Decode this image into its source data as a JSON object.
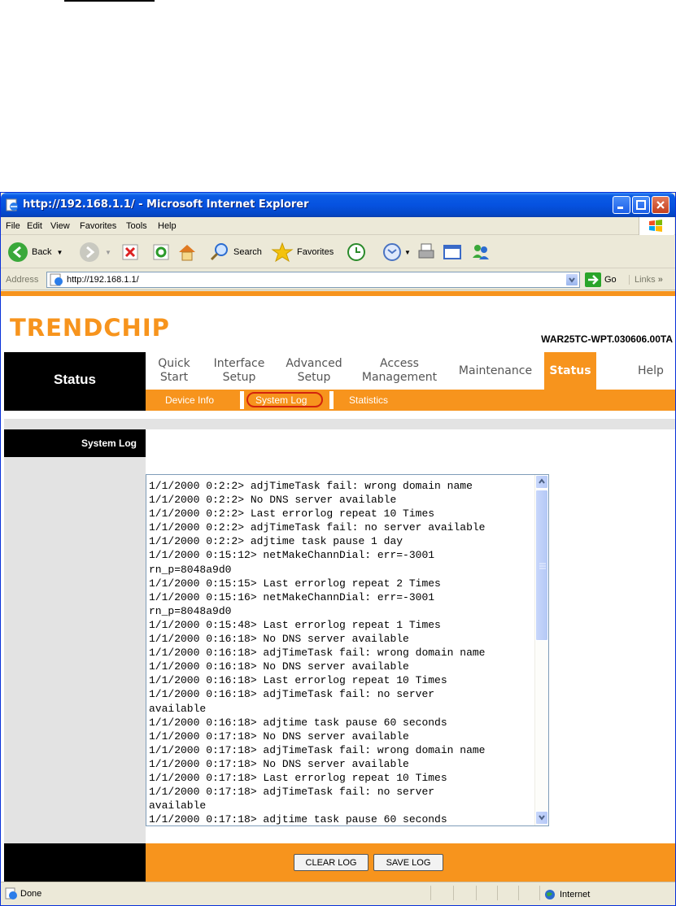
{
  "window": {
    "title": "http://192.168.1.1/ - Microsoft Internet Explorer"
  },
  "menu": [
    "File",
    "Edit",
    "View",
    "Favorites",
    "Tools",
    "Help"
  ],
  "toolbar": {
    "back": "Back",
    "search": "Search",
    "favorites": "Favorites"
  },
  "address": {
    "label": "Address",
    "url": "http://192.168.1.1/",
    "go": "Go",
    "links": "Links"
  },
  "page": {
    "brand": "TRENDCHIP",
    "firmware": "WAR25TC-WPT.030606.00TA",
    "section": "Status",
    "tabs": [
      {
        "label": "Quick\nStart"
      },
      {
        "label": "Interface\nSetup"
      },
      {
        "label": "Advanced\nSetup"
      },
      {
        "label": "Access\nManagement"
      },
      {
        "label": "Maintenance"
      },
      {
        "label": "Status"
      },
      {
        "label": "Help"
      }
    ],
    "subtabs": [
      "Device Info",
      "System Log",
      "Statistics"
    ],
    "active_subtab": "System Log",
    "side_title": "System Log",
    "log": [
      "1/1/2000 0:2:2> adjTimeTask fail: wrong domain name",
      "1/1/2000 0:2:2> No DNS server available",
      "1/1/2000 0:2:2> Last errorlog repeat 10 Times",
      "1/1/2000 0:2:2> adjTimeTask fail: no server available",
      "1/1/2000 0:2:2> adjtime task pause 1 day",
      "1/1/2000 0:15:12> netMakeChannDial: err=-3001",
      "rn_p=8048a9d0",
      "1/1/2000 0:15:15> Last errorlog repeat 2 Times",
      "1/1/2000 0:15:16> netMakeChannDial: err=-3001",
      "rn_p=8048a9d0",
      "1/1/2000 0:15:48> Last errorlog repeat 1 Times",
      "1/1/2000 0:16:18> No DNS server available",
      "1/1/2000 0:16:18> adjTimeTask fail: wrong domain name",
      "1/1/2000 0:16:18> No DNS server available",
      "1/1/2000 0:16:18> Last errorlog repeat 10 Times",
      "1/1/2000 0:16:18> adjTimeTask fail: no server",
      "available",
      "1/1/2000 0:16:18> adjtime task pause 60 seconds",
      "1/1/2000 0:17:18> No DNS server available",
      "1/1/2000 0:17:18> adjTimeTask fail: wrong domain name",
      "1/1/2000 0:17:18> No DNS server available",
      "1/1/2000 0:17:18> Last errorlog repeat 10 Times",
      "1/1/2000 0:17:18> adjTimeTask fail: no server",
      "available",
      "1/1/2000 0:17:18> adjtime task pause 60 seconds"
    ],
    "buttons": {
      "clear": "CLEAR LOG",
      "save": "SAVE LOG"
    }
  },
  "status": {
    "text": "Done",
    "zone": "Internet"
  },
  "colors": {
    "brand_orange": "#f7941d",
    "xp_blue": "#0652e0",
    "nav_black": "#000000"
  }
}
